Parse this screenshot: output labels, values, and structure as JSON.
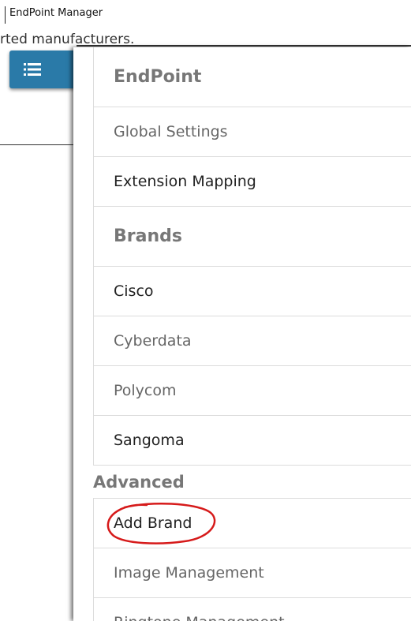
{
  "window": {
    "title": "EndPoint Manager"
  },
  "background": {
    "fragment_text": "rted manufacturers."
  },
  "menu_toggle": {
    "icon": "list-icon",
    "color": "#2a7aa8"
  },
  "menu": {
    "endpoint_header": "EndPoint",
    "global_settings": "Global Settings",
    "extension_mapping": "Extension Mapping",
    "brands_header": "Brands",
    "brands": [
      {
        "label": "Cisco"
      },
      {
        "label": "Cyberdata"
      },
      {
        "label": "Polycom"
      },
      {
        "label": "Sangoma"
      }
    ],
    "advanced_header": "Advanced",
    "add_brand": "Add Brand",
    "image_management": "Image Management",
    "ringtone_management": "Ringtone Management"
  },
  "annotation": {
    "color": "#d61a1a",
    "target": "Add Brand"
  }
}
